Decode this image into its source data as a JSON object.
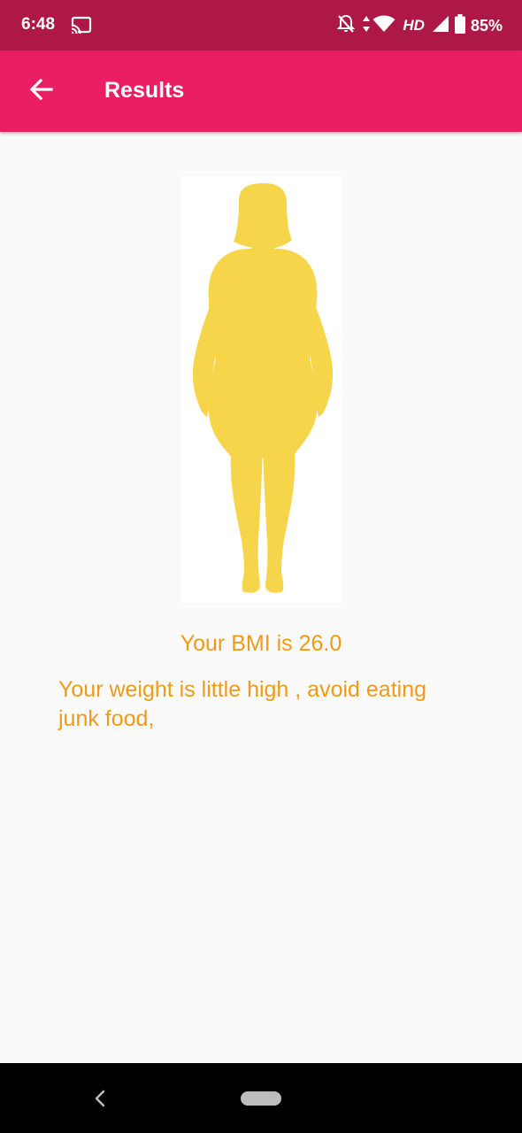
{
  "status_bar": {
    "time": "6:48",
    "network": "HD",
    "battery": "85%",
    "icons": [
      "cast-icon",
      "bell-off-icon",
      "data-arrows-icon",
      "wifi-icon",
      "signal-icon",
      "battery-icon"
    ]
  },
  "app_bar": {
    "title": "Results",
    "back_icon": "arrow-back-icon"
  },
  "result": {
    "figure": "body-silhouette",
    "figure_color": "#f7d54a",
    "bmi_text": "Your BMI is 26.0",
    "advice_text": "Your weight is little high , avoid eating junk food,"
  },
  "colors": {
    "status_bar": "#ad1846",
    "app_bar": "#e91e63",
    "accent_text": "#f29a16",
    "background": "#fafafa"
  },
  "nav_bar": {
    "icons": [
      "nav-back-icon",
      "home-pill-icon"
    ]
  }
}
